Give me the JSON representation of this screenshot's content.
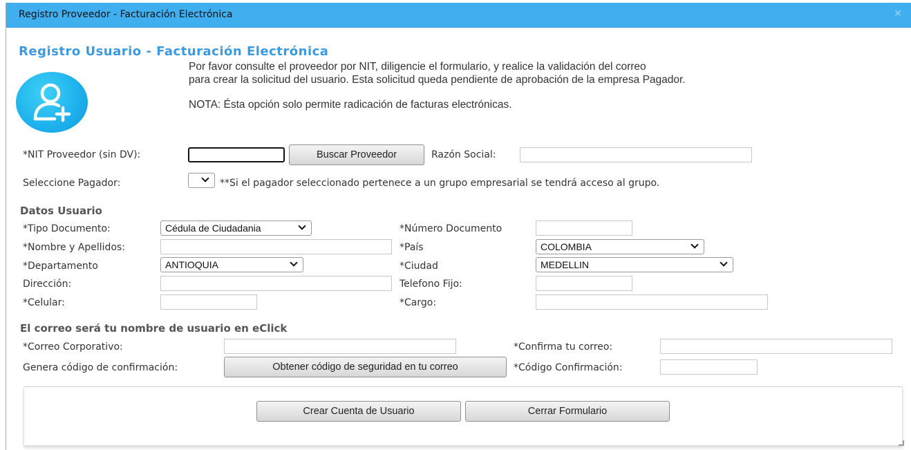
{
  "window": {
    "title": "Registro Proveedor - Facturación Electrónica",
    "close_glyph": "✕"
  },
  "header": {
    "title": "Registro Usuario - Facturación Electrónica",
    "icon": "add-user-icon",
    "accent_color": "#3a9be0"
  },
  "intro": {
    "line1": "Por favor consulte el proveedor por NIT, diligencie el formulario, y realice la validación del correo",
    "line2": "para crear la solicitud del usuario. Esta solicitud queda pendiente de aprobación de la empresa Pagador.",
    "note": "NOTA: Ésta opción solo permite radicación de facturas electrónicas."
  },
  "proveedor": {
    "nit_label": "*NIT Proveedor (sin DV):",
    "nit_value": "",
    "search_button": "Buscar Proveedor",
    "razon_label": "Razón Social:",
    "razon_value": "",
    "pagador_label": "Seleccione Pagador:",
    "pagador_value": "",
    "pagador_note": "**Si el pagador seleccionado pertenece a un grupo empresarial se tendrá acceso al grupo."
  },
  "usuario": {
    "section_title": "Datos Usuario",
    "tipo_doc_label": "*Tipo Documento:",
    "tipo_doc_value": "Cédula de Ciudadania",
    "num_doc_label": "*Número Documento",
    "num_doc_value": "",
    "nombre_label": "*Nombre y Apellidos:",
    "nombre_value": "",
    "pais_label": "*País",
    "pais_value": "COLOMBIA",
    "depto_label": "*Departamento",
    "depto_value": "ANTIOQUIA",
    "ciudad_label": "*Ciudad",
    "ciudad_value": "MEDELLIN",
    "direccion_label": "Dirección:",
    "direccion_value": "",
    "telefono_label": "Telefono Fijo:",
    "telefono_value": "",
    "celular_label": "*Celular:",
    "celular_value": "",
    "cargo_label": "*Cargo:",
    "cargo_value": ""
  },
  "correo": {
    "section_title": "El correo será tu nombre de usuario en eClick",
    "corporativo_label": "*Correo Corporativo:",
    "corporativo_value": "",
    "confirma_label": "*Confirma tu correo:",
    "confirma_value": "",
    "genera_label": "Genera código de confirmación:",
    "obtener_button": "Obtener código de seguridad en tu correo",
    "codigo_label": "*Código Confirmación:",
    "codigo_value": ""
  },
  "actions": {
    "crear_button": "Crear Cuenta de Usuario",
    "cerrar_button": "Cerrar Formulario"
  }
}
